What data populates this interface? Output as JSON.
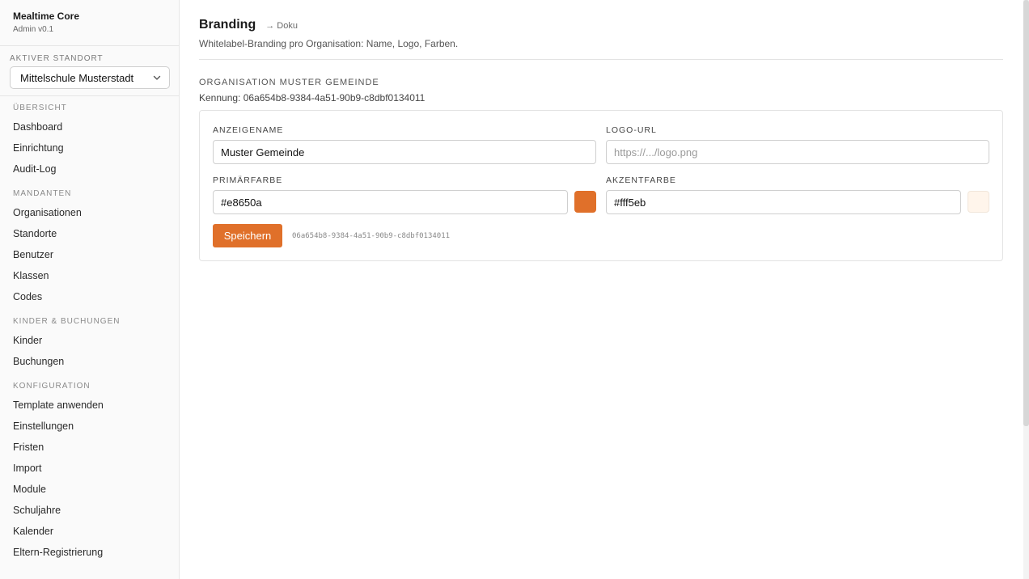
{
  "app": {
    "title": "Mealtime Core",
    "version": "Admin v0.1"
  },
  "location": {
    "label": "AKTIVER STANDORT",
    "selected": "Mittelschule Musterstadt"
  },
  "nav": {
    "sections": [
      {
        "label": "ÜBERSICHT",
        "items": [
          "Dashboard",
          "Einrichtung",
          "Audit-Log"
        ]
      },
      {
        "label": "MANDANTEN",
        "items": [
          "Organisationen",
          "Standorte",
          "Benutzer",
          "Klassen",
          "Codes"
        ]
      },
      {
        "label": "KINDER & BUCHUNGEN",
        "items": [
          "Kinder",
          "Buchungen"
        ]
      },
      {
        "label": "KONFIGURATION",
        "items": [
          "Template anwenden",
          "Einstellungen",
          "Fristen",
          "Import",
          "Module",
          "Schuljahre",
          "Kalender",
          "Eltern-Registrierung"
        ]
      }
    ]
  },
  "page": {
    "title": "Branding",
    "doc_link": "→ Doku",
    "subtitle": "Whitelabel-Branding pro Organisation: Name, Logo, Farben."
  },
  "org": {
    "label": "ORGANISATION MUSTER GEMEINDE",
    "id_text": "Kennung: 06a654b8-9384-4a51-90b9-c8dbf0134011"
  },
  "form": {
    "display_name": {
      "label": "ANZEIGENAME",
      "value": "Muster Gemeinde"
    },
    "logo_url": {
      "label": "LOGO-URL",
      "placeholder": "https://.../logo.png"
    },
    "primary_color": {
      "label": "PRIMÄRFARBE",
      "value": "#e8650a"
    },
    "accent_color": {
      "label": "AKZENTFARBE",
      "value": "#fff5eb"
    },
    "save_label": "Speichern",
    "save_id": "06a654b8-9384-4a51-90b9-c8dbf0134011"
  },
  "colors": {
    "primary_swatch": "#e0702a",
    "accent_swatch": "#fff5eb",
    "button": "#e0702a"
  }
}
